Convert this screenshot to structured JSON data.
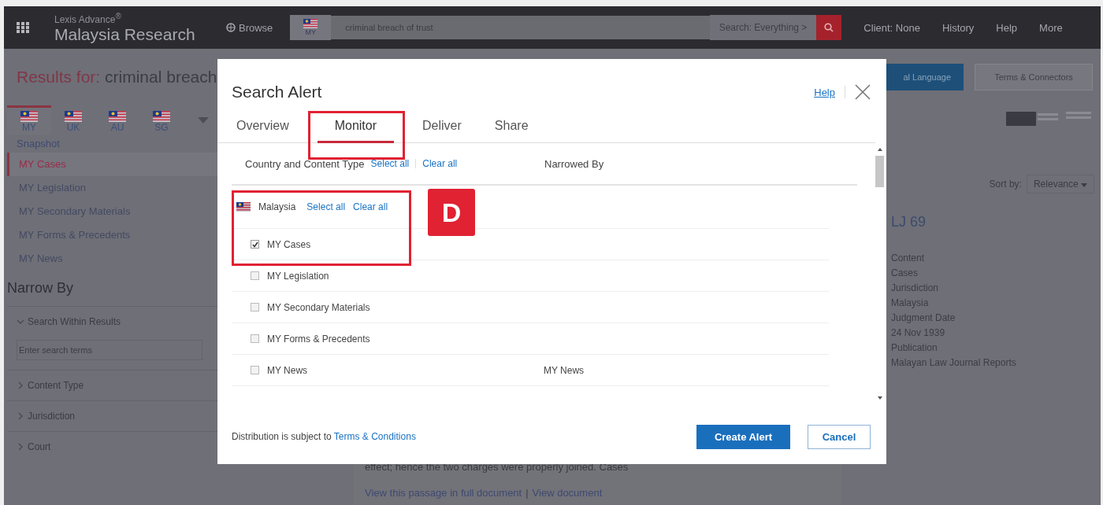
{
  "header": {
    "brand_small": "Lexis Advance$^{®}$",
    "brand": "Malaysia Research",
    "browse": "Browse",
    "search": {
      "jurisdiction": "MY",
      "value": "criminal breach of trust",
      "scope": "Search: Everything >"
    },
    "links": [
      "Client: None",
      "History",
      "Help",
      "More"
    ]
  },
  "results_bar": {
    "label": "Results for:",
    "query": "criminal breach",
    "buttons": [
      {
        "label": "al Language",
        "kind": "primary"
      },
      {
        "label": "Terms & Connectors",
        "kind": "secondary"
      }
    ]
  },
  "sidebar": {
    "jurisdictions": [
      {
        "label": "MY",
        "selected": true
      },
      {
        "label": "UK",
        "selected": false
      },
      {
        "label": "AU",
        "selected": false
      },
      {
        "label": "SG",
        "selected": false
      }
    ],
    "snapshot": "Snapshot",
    "categories": [
      {
        "label": "MY Cases",
        "selected": true
      },
      {
        "label": "MY Legislation",
        "selected": false
      },
      {
        "label": "MY Secondary Materials",
        "selected": false
      },
      {
        "label": "MY Forms & Precedents",
        "selected": false
      },
      {
        "label": "MY News",
        "selected": false
      }
    ],
    "narrow_title": "Narrow By",
    "filters": [
      {
        "label": "Search Within Results",
        "expanded": true,
        "placeholder": "Enter search terms"
      },
      {
        "label": "Content Type",
        "expanded": false
      },
      {
        "label": "Jurisdiction",
        "expanded": false
      },
      {
        "label": "Court",
        "expanded": false
      }
    ]
  },
  "sort": {
    "label": "Sort by:",
    "value": "Relevance"
  },
  "result": {
    "citation": "LJ 69",
    "fields": [
      "Content",
      "Cases",
      "Jurisdiction",
      "Malaysia",
      "Judgment Date",
      "24 Nov 1939",
      "Publication",
      "Malayan Law Journal Reports"
    ],
    "snippet": "effect; hence the two charges were properly joined. Cases",
    "links": [
      "View this passage in full document",
      "View document"
    ],
    "separator": "|"
  },
  "modal": {
    "title": "Search Alert",
    "help": "Help",
    "tabs": [
      {
        "label": "Overview",
        "selected": false
      },
      {
        "label": "Monitor",
        "selected": true
      },
      {
        "label": "Deliver",
        "selected": false
      },
      {
        "label": "Share",
        "selected": false
      }
    ],
    "columns": {
      "left": "Country and Content Type",
      "select_all": "Select all",
      "clear_all": "Clear all",
      "right": "Narrowed By"
    },
    "country": {
      "name": "Malaysia",
      "select_all": "Select all",
      "clear_all": "Clear all"
    },
    "items": [
      {
        "label": "MY Cases",
        "checked": true
      },
      {
        "label": "MY Legislation",
        "checked": false
      },
      {
        "label": "MY Secondary Materials",
        "checked": false
      },
      {
        "label": "MY Forms & Precedents",
        "checked": false
      },
      {
        "label": "MY News",
        "checked": false,
        "narrowed": "MY News"
      }
    ],
    "footer": {
      "text": "Distribution is subject to ",
      "link": "Terms & Conditions"
    },
    "buttons": [
      {
        "label": "Create Alert",
        "kind": "primary"
      },
      {
        "label": "Cancel",
        "kind": "secondary"
      }
    ]
  },
  "annotation": {
    "badge": "D"
  }
}
